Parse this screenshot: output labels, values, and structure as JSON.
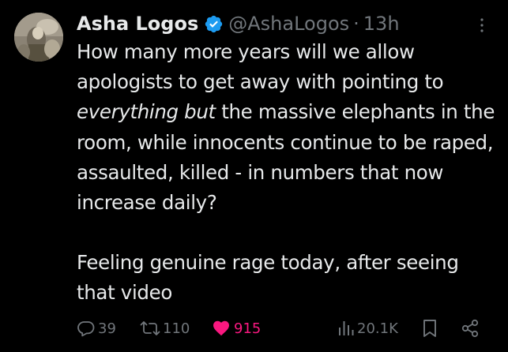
{
  "tweet": {
    "author": {
      "display_name": "Asha Logos",
      "handle": "@AshaLogos",
      "verified_icon": "verified-badge-icon"
    },
    "separator": "·",
    "time": "13h",
    "body": {
      "line1_pre": "How many more years will we allow apologists to get away with pointing to ",
      "line1_emph": "everything but",
      "line1_post": " the massive elephants in the room, while innocents continue to be raped, assaulted, killed - in numbers that now increase daily?",
      "para2": "Feeling genuine rage today, after seeing that video"
    },
    "actions": {
      "replies": "39",
      "retweets": "110",
      "likes": "915",
      "views": "20.1K"
    },
    "icons": {
      "more": "more-options-icon",
      "reply": "reply-icon",
      "retweet": "retweet-icon",
      "like": "heart-icon",
      "views": "views-icon",
      "bookmark": "bookmark-icon",
      "share": "share-icon"
    },
    "colors": {
      "background": "#000000",
      "text": "#e7e9ea",
      "muted": "#71767b",
      "verified": "#1d9bf0",
      "like": "#f91880"
    }
  }
}
